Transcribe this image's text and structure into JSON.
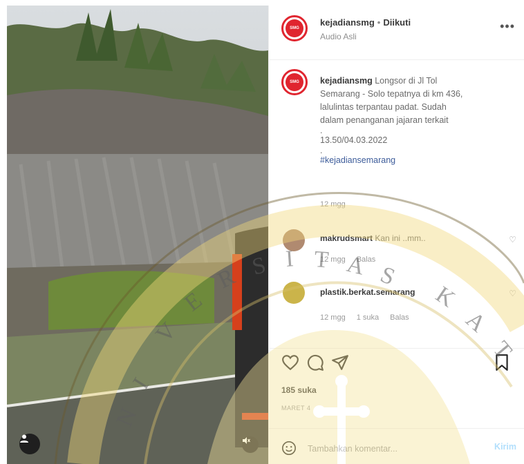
{
  "post": {
    "username": "kejadiansmg",
    "separator": "•",
    "follow_status": "Diikuti",
    "audio": "Audio Asli",
    "more_icon": "more-horizontal-icon",
    "caption": {
      "username": "kejadiansmg",
      "lines": [
        "Longsor di Jl Tol",
        "Semarang - Solo tepatnya di km 436,",
        "lalulintas terpantau padat. Sudah",
        "dalam penanganan jajaran terkait"
      ],
      "dot1": ".",
      "timestamp": "13.50/04.03.2022",
      "dot2": ".",
      "hashtag": "#kejadiansemarang",
      "age": "12 mgg"
    },
    "comments": [
      {
        "username": "makrudsmart",
        "text": "Kan ini ..mm..",
        "age": "12 mgg",
        "reply": "Balas"
      },
      {
        "username": "plastik.berkat.semarang",
        "text": "",
        "age": "12 mgg",
        "likes": "1 suka",
        "reply": "Balas"
      }
    ],
    "likes": "185 suka",
    "date_label": "MARET 4",
    "comment_placeholder": "Tambahkan komentar...",
    "post_button": "Kirim",
    "icons": [
      "heart-icon",
      "comment-icon",
      "share-icon",
      "bookmark-icon",
      "emoji-icon",
      "user-tag-icon",
      "mute-icon"
    ],
    "colors": {
      "brand_red": "#e0252f",
      "link_blue": "#3d5c9a",
      "muted_text": "#8e8e8e",
      "watermark_yellow": "#f3d97a"
    }
  },
  "watermark": {
    "letters": [
      "V",
      "E",
      "R",
      "S",
      "I",
      "T",
      "A",
      "S",
      "K",
      "A",
      "T"
    ],
    "left_letters": [
      "N",
      "I"
    ]
  }
}
